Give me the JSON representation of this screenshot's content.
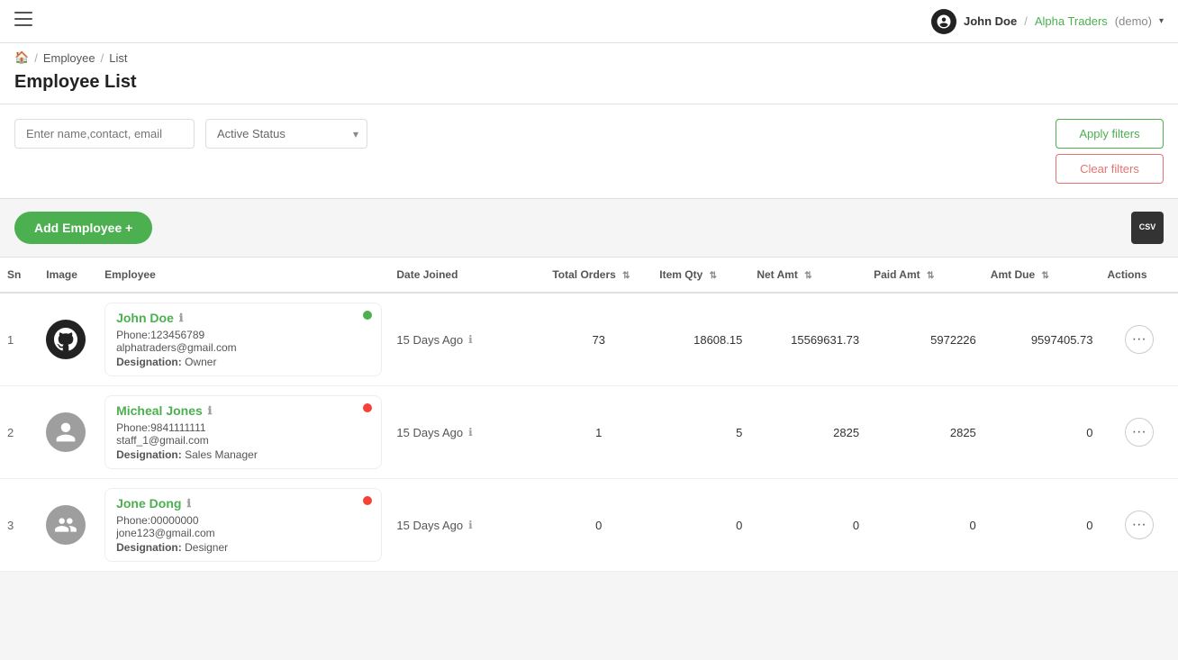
{
  "topnav": {
    "hamburger_label": "☰",
    "user_name": "John Doe",
    "separator": "/",
    "company_name": "Alpha Traders",
    "demo_badge": "(demo)",
    "chevron": "▾"
  },
  "breadcrumb": {
    "home_icon": "🏠",
    "separator1": "/",
    "employee_link": "Employee",
    "separator2": "/",
    "current": "List"
  },
  "page": {
    "title": "Employee List"
  },
  "filters": {
    "search_placeholder": "Enter name,contact, email",
    "status_placeholder": "Active Status",
    "apply_label": "Apply filters",
    "clear_label": "Clear filters"
  },
  "actions": {
    "add_employee_label": "Add Employee +",
    "csv_label": "CSV"
  },
  "table": {
    "columns": {
      "sn": "Sn",
      "image": "Image",
      "employee": "Employee",
      "date_joined": "Date Joined",
      "total_orders": "Total Orders",
      "item_qty": "Item Qty",
      "net_amt": "Net Amt",
      "paid_amt": "Paid Amt",
      "amt_due": "Amt Due",
      "actions": "Actions"
    },
    "rows": [
      {
        "sn": 1,
        "avatar_type": "github",
        "name": "John Doe",
        "status": "online",
        "phone": "Phone:123456789",
        "email": "alphatraders@gmail.com",
        "designation_label": "Designation:",
        "designation": "Owner",
        "date_joined": "15 Days Ago",
        "total_orders": "73",
        "item_qty": "18608.15",
        "net_amt": "15569631.73",
        "paid_amt": "5972226",
        "amt_due": "9597405.73"
      },
      {
        "sn": 2,
        "avatar_type": "person",
        "name": "Micheal Jones",
        "status": "offline",
        "phone": "Phone:9841111111",
        "email": "staff_1@gmail.com",
        "designation_label": "Designation:",
        "designation": "Sales Manager",
        "date_joined": "15 Days Ago",
        "total_orders": "1",
        "item_qty": "5",
        "net_amt": "2825",
        "paid_amt": "2825",
        "amt_due": "0"
      },
      {
        "sn": 3,
        "avatar_type": "group",
        "name": "Jone Dong",
        "status": "offline",
        "phone": "Phone:00000000",
        "email": "jone123@gmail.com",
        "designation_label": "Designation:",
        "designation": "Designer",
        "date_joined": "15 Days Ago",
        "total_orders": "0",
        "item_qty": "0",
        "net_amt": "0",
        "paid_amt": "0",
        "amt_due": "0"
      }
    ]
  }
}
